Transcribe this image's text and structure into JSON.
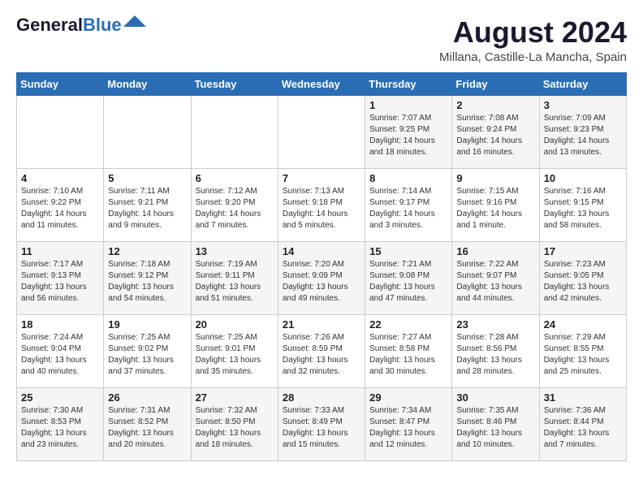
{
  "header": {
    "logo_general": "General",
    "logo_blue": "Blue",
    "month_year": "August 2024",
    "location": "Millana, Castille-La Mancha, Spain"
  },
  "days_of_week": [
    "Sunday",
    "Monday",
    "Tuesday",
    "Wednesday",
    "Thursday",
    "Friday",
    "Saturday"
  ],
  "weeks": [
    [
      {
        "day": "",
        "text": ""
      },
      {
        "day": "",
        "text": ""
      },
      {
        "day": "",
        "text": ""
      },
      {
        "day": "",
        "text": ""
      },
      {
        "day": "1",
        "text": "Sunrise: 7:07 AM\nSunset: 9:25 PM\nDaylight: 14 hours\nand 18 minutes."
      },
      {
        "day": "2",
        "text": "Sunrise: 7:08 AM\nSunset: 9:24 PM\nDaylight: 14 hours\nand 16 minutes."
      },
      {
        "day": "3",
        "text": "Sunrise: 7:09 AM\nSunset: 9:23 PM\nDaylight: 14 hours\nand 13 minutes."
      }
    ],
    [
      {
        "day": "4",
        "text": "Sunrise: 7:10 AM\nSunset: 9:22 PM\nDaylight: 14 hours\nand 11 minutes."
      },
      {
        "day": "5",
        "text": "Sunrise: 7:11 AM\nSunset: 9:21 PM\nDaylight: 14 hours\nand 9 minutes."
      },
      {
        "day": "6",
        "text": "Sunrise: 7:12 AM\nSunset: 9:20 PM\nDaylight: 14 hours\nand 7 minutes."
      },
      {
        "day": "7",
        "text": "Sunrise: 7:13 AM\nSunset: 9:18 PM\nDaylight: 14 hours\nand 5 minutes."
      },
      {
        "day": "8",
        "text": "Sunrise: 7:14 AM\nSunset: 9:17 PM\nDaylight: 14 hours\nand 3 minutes."
      },
      {
        "day": "9",
        "text": "Sunrise: 7:15 AM\nSunset: 9:16 PM\nDaylight: 14 hours\nand 1 minute."
      },
      {
        "day": "10",
        "text": "Sunrise: 7:16 AM\nSunset: 9:15 PM\nDaylight: 13 hours\nand 58 minutes."
      }
    ],
    [
      {
        "day": "11",
        "text": "Sunrise: 7:17 AM\nSunset: 9:13 PM\nDaylight: 13 hours\nand 56 minutes."
      },
      {
        "day": "12",
        "text": "Sunrise: 7:18 AM\nSunset: 9:12 PM\nDaylight: 13 hours\nand 54 minutes."
      },
      {
        "day": "13",
        "text": "Sunrise: 7:19 AM\nSunset: 9:11 PM\nDaylight: 13 hours\nand 51 minutes."
      },
      {
        "day": "14",
        "text": "Sunrise: 7:20 AM\nSunset: 9:09 PM\nDaylight: 13 hours\nand 49 minutes."
      },
      {
        "day": "15",
        "text": "Sunrise: 7:21 AM\nSunset: 9:08 PM\nDaylight: 13 hours\nand 47 minutes."
      },
      {
        "day": "16",
        "text": "Sunrise: 7:22 AM\nSunset: 9:07 PM\nDaylight: 13 hours\nand 44 minutes."
      },
      {
        "day": "17",
        "text": "Sunrise: 7:23 AM\nSunset: 9:05 PM\nDaylight: 13 hours\nand 42 minutes."
      }
    ],
    [
      {
        "day": "18",
        "text": "Sunrise: 7:24 AM\nSunset: 9:04 PM\nDaylight: 13 hours\nand 40 minutes."
      },
      {
        "day": "19",
        "text": "Sunrise: 7:25 AM\nSunset: 9:02 PM\nDaylight: 13 hours\nand 37 minutes."
      },
      {
        "day": "20",
        "text": "Sunrise: 7:25 AM\nSunset: 9:01 PM\nDaylight: 13 hours\nand 35 minutes."
      },
      {
        "day": "21",
        "text": "Sunrise: 7:26 AM\nSunset: 8:59 PM\nDaylight: 13 hours\nand 32 minutes."
      },
      {
        "day": "22",
        "text": "Sunrise: 7:27 AM\nSunset: 8:58 PM\nDaylight: 13 hours\nand 30 minutes."
      },
      {
        "day": "23",
        "text": "Sunrise: 7:28 AM\nSunset: 8:56 PM\nDaylight: 13 hours\nand 28 minutes."
      },
      {
        "day": "24",
        "text": "Sunrise: 7:29 AM\nSunset: 8:55 PM\nDaylight: 13 hours\nand 25 minutes."
      }
    ],
    [
      {
        "day": "25",
        "text": "Sunrise: 7:30 AM\nSunset: 8:53 PM\nDaylight: 13 hours\nand 23 minutes."
      },
      {
        "day": "26",
        "text": "Sunrise: 7:31 AM\nSunset: 8:52 PM\nDaylight: 13 hours\nand 20 minutes."
      },
      {
        "day": "27",
        "text": "Sunrise: 7:32 AM\nSunset: 8:50 PM\nDaylight: 13 hours\nand 18 minutes."
      },
      {
        "day": "28",
        "text": "Sunrise: 7:33 AM\nSunset: 8:49 PM\nDaylight: 13 hours\nand 15 minutes."
      },
      {
        "day": "29",
        "text": "Sunrise: 7:34 AM\nSunset: 8:47 PM\nDaylight: 13 hours\nand 12 minutes."
      },
      {
        "day": "30",
        "text": "Sunrise: 7:35 AM\nSunset: 8:46 PM\nDaylight: 13 hours\nand 10 minutes."
      },
      {
        "day": "31",
        "text": "Sunrise: 7:36 AM\nSunset: 8:44 PM\nDaylight: 13 hours\nand 7 minutes."
      }
    ]
  ]
}
